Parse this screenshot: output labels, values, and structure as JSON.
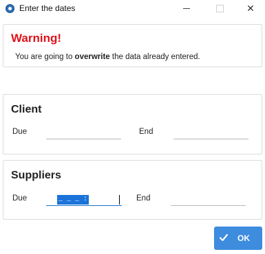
{
  "window": {
    "title": "Enter the dates",
    "close_glyph": "✕"
  },
  "warning": {
    "title": "Warning!",
    "message_before": "You are going to ",
    "message_bold": "overwrite",
    "message_after": " the data already entered."
  },
  "client": {
    "title": "Client",
    "due_label": "Due",
    "end_label": "End",
    "due_value": "",
    "end_value": ""
  },
  "suppliers": {
    "title": "Suppliers",
    "due_label": "Due",
    "end_label": "End",
    "due_value": "_ _ _ :",
    "end_value": ""
  },
  "ok_button": {
    "label": "OK"
  },
  "colors": {
    "warning": "#e0131b",
    "accent": "#3e8cde"
  }
}
